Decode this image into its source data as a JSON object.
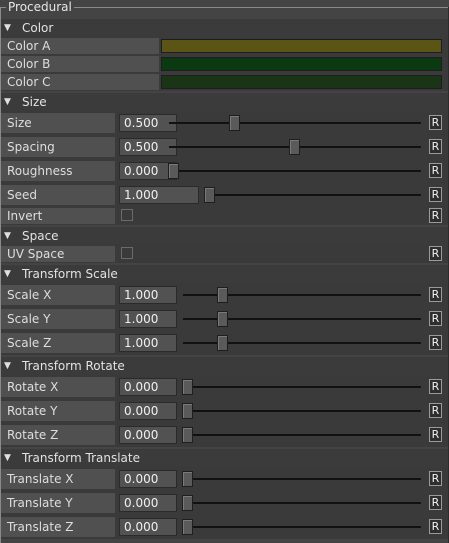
{
  "panel": {
    "title": "Procedural"
  },
  "sections": {
    "color": {
      "title": "Color",
      "items": [
        {
          "label": "Color A",
          "swatch": "#5a5415"
        },
        {
          "label": "Color B",
          "swatch": "#0b3a12"
        },
        {
          "label": "Color C",
          "swatch": "#1a3515"
        }
      ]
    },
    "size": {
      "title": "Size",
      "size": {
        "label": "Size",
        "value": "0.500",
        "fraction": 0.25
      },
      "spacing": {
        "label": "Spacing",
        "value": "0.500",
        "fraction": 0.5
      },
      "roughness": {
        "label": "Roughness",
        "value": "0.000",
        "fraction": 0.0
      },
      "seed": {
        "label": "Seed",
        "value": "1.000",
        "fraction": 0.0
      },
      "invert": {
        "label": "Invert",
        "checked": false
      }
    },
    "space": {
      "title": "Space",
      "uv_space": {
        "label": "UV Space",
        "checked": false
      }
    },
    "transform_scale": {
      "title": "Transform Scale",
      "x": {
        "label": "Scale X",
        "value": "1.000"
      },
      "y": {
        "label": "Scale Y",
        "value": "1.000"
      },
      "z": {
        "label": "Scale Z",
        "value": "1.000"
      }
    },
    "transform_rotate": {
      "title": "Transform Rotate",
      "x": {
        "label": "Rotate X",
        "value": "0.000"
      },
      "y": {
        "label": "Rotate Y",
        "value": "0.000"
      },
      "z": {
        "label": "Rotate Z",
        "value": "0.000"
      }
    },
    "transform_translate": {
      "title": "Transform Translate",
      "x": {
        "label": "Translate X",
        "value": "0.000"
      },
      "y": {
        "label": "Translate Y",
        "value": "0.000"
      },
      "z": {
        "label": "Translate Z",
        "value": "0.000"
      }
    }
  },
  "reset_label": "R",
  "expanded_glyph": "▼"
}
